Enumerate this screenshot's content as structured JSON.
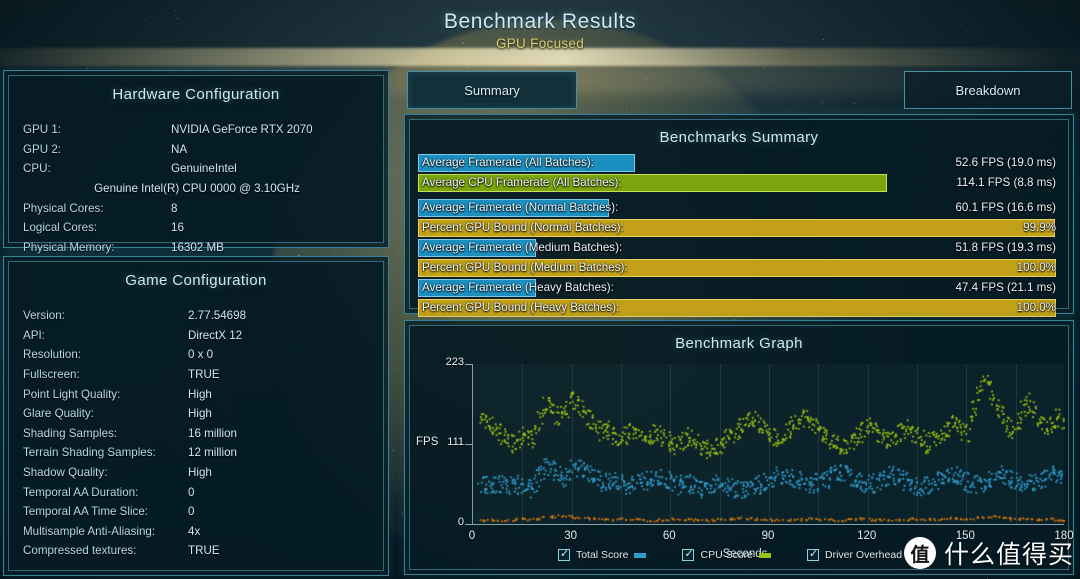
{
  "header": {
    "title": "Benchmark Results",
    "subtitle": "GPU Focused"
  },
  "tabs": [
    {
      "id": "summary",
      "label": "Summary",
      "active": true
    },
    {
      "id": "breakdown",
      "label": "Breakdown",
      "active": false
    }
  ],
  "hardware": {
    "title": "Hardware Configuration",
    "rows": [
      {
        "key": "GPU 1:",
        "value": "NVIDIA GeForce RTX 2070"
      },
      {
        "key": "GPU 2:",
        "value": "NA"
      },
      {
        "key": "CPU:",
        "value": "GenuineIntel"
      },
      {
        "key": "",
        "value": "Genuine Intel(R) CPU 0000 @ 3.10GHz",
        "center": true
      },
      {
        "key": "Physical Cores:",
        "value": "8"
      },
      {
        "key": "Logical Cores:",
        "value": "16"
      },
      {
        "key": "Physical Memory:",
        "value": "16302  MB"
      }
    ]
  },
  "game": {
    "title": "Game Configuration",
    "rows": [
      {
        "key": "Version:",
        "value": "2.77.54698"
      },
      {
        "key": "API:",
        "value": "DirectX 12"
      },
      {
        "key": "Resolution:",
        "value": "0 x 0"
      },
      {
        "key": "Fullscreen:",
        "value": "TRUE"
      },
      {
        "key": "Point Light Quality:",
        "value": "High"
      },
      {
        "key": "Glare Quality:",
        "value": "High"
      },
      {
        "key": "Shading Samples:",
        "value": "16 million"
      },
      {
        "key": "Terrain Shading Samples:",
        "value": "12 million"
      },
      {
        "key": "Shadow Quality:",
        "value": "High"
      },
      {
        "key": "Temporal AA Duration:",
        "value": "0"
      },
      {
        "key": "Temporal AA Time Slice:",
        "value": "0"
      },
      {
        "key": "Multisample Anti-Aliasing:",
        "value": "4x"
      },
      {
        "key": "Compressed textures:",
        "value": "TRUE"
      }
    ]
  },
  "summary": {
    "title": "Benchmarks Summary",
    "rows": [
      {
        "label": "Average Framerate (All Batches):",
        "value": "52.6 FPS (19.0 ms)",
        "color": "blue",
        "fill_pct": 34.0,
        "gap": false
      },
      {
        "label": "Average CPU Framerate (All Batches):",
        "value": "114.1 FPS (8.8 ms)",
        "color": "green",
        "fill_pct": 73.5,
        "gap": true
      },
      {
        "label": "Average Framerate (Normal Batches):",
        "value": "60.1 FPS (16.6 ms)",
        "color": "blue",
        "fill_pct": 30.0,
        "gap": false
      },
      {
        "label": "Percent GPU Bound (Normal Batches):",
        "value": "99.9%",
        "color": "gold",
        "fill_pct": 99.9,
        "gap": false
      },
      {
        "label": "Average Framerate (Medium Batches):",
        "value": "51.8 FPS (19.3 ms)",
        "color": "blue",
        "fill_pct": 18.5,
        "gap": false
      },
      {
        "label": "Percent GPU Bound (Medium Batches):",
        "value": "100.0%",
        "color": "gold",
        "fill_pct": 100.0,
        "gap": false
      },
      {
        "label": "Average Framerate (Heavy Batches):",
        "value": "47.4 FPS (21.1 ms)",
        "color": "blue",
        "fill_pct": 18.5,
        "gap": false
      },
      {
        "label": "Percent GPU Bound (Heavy Batches):",
        "value": "100.0%",
        "color": "gold",
        "fill_pct": 100.0,
        "gap": false
      }
    ]
  },
  "graph": {
    "title": "Benchmark Graph"
  },
  "chart_data": {
    "type": "scatter",
    "title": "Benchmark Graph",
    "xlabel": "Seconds",
    "ylabel": "FPS",
    "xlim": [
      0,
      180
    ],
    "ylim": [
      0,
      223
    ],
    "xticks": [
      0,
      30,
      60,
      90,
      120,
      150,
      180
    ],
    "yticks": [
      0,
      111,
      223
    ],
    "grid": true,
    "legend_position": "bottom",
    "series": [
      {
        "name": "Total Score",
        "color": "#2f9fd0",
        "checked": true,
        "approx_range_fps": [
          42,
          95
        ],
        "mean_fps": 52.6,
        "points": [
          [
            2,
            58
          ],
          [
            4,
            56
          ],
          [
            6,
            54
          ],
          [
            8,
            57
          ],
          [
            10,
            55
          ],
          [
            12,
            53
          ],
          [
            14,
            56
          ],
          [
            16,
            52
          ],
          [
            18,
            50
          ],
          [
            20,
            72
          ],
          [
            22,
            80
          ],
          [
            24,
            76
          ],
          [
            26,
            70
          ],
          [
            28,
            66
          ],
          [
            30,
            78
          ],
          [
            32,
            82
          ],
          [
            34,
            74
          ],
          [
            36,
            68
          ],
          [
            38,
            62
          ],
          [
            40,
            58
          ],
          [
            42,
            64
          ],
          [
            44,
            60
          ],
          [
            46,
            56
          ],
          [
            48,
            54
          ],
          [
            50,
            58
          ],
          [
            52,
            62
          ],
          [
            54,
            66
          ],
          [
            56,
            70
          ],
          [
            58,
            64
          ],
          [
            60,
            58
          ],
          [
            62,
            54
          ],
          [
            64,
            60
          ],
          [
            66,
            56
          ],
          [
            68,
            52
          ],
          [
            70,
            50
          ],
          [
            72,
            54
          ],
          [
            74,
            58
          ],
          [
            76,
            56
          ],
          [
            78,
            52
          ],
          [
            80,
            48
          ],
          [
            82,
            46
          ],
          [
            84,
            50
          ],
          [
            86,
            54
          ],
          [
            88,
            58
          ],
          [
            90,
            62
          ],
          [
            92,
            66
          ],
          [
            94,
            70
          ],
          [
            96,
            68
          ],
          [
            98,
            64
          ],
          [
            100,
            60
          ],
          [
            102,
            56
          ],
          [
            104,
            58
          ],
          [
            106,
            62
          ],
          [
            108,
            66
          ],
          [
            110,
            70
          ],
          [
            112,
            72
          ],
          [
            114,
            68
          ],
          [
            116,
            64
          ],
          [
            118,
            60
          ],
          [
            120,
            56
          ],
          [
            122,
            58
          ],
          [
            124,
            62
          ],
          [
            126,
            66
          ],
          [
            128,
            70
          ],
          [
            130,
            64
          ],
          [
            132,
            58
          ],
          [
            134,
            54
          ],
          [
            136,
            52
          ],
          [
            138,
            56
          ],
          [
            140,
            60
          ],
          [
            142,
            64
          ],
          [
            144,
            68
          ],
          [
            146,
            72
          ],
          [
            148,
            66
          ],
          [
            150,
            60
          ],
          [
            152,
            56
          ],
          [
            154,
            58
          ],
          [
            156,
            62
          ],
          [
            158,
            66
          ],
          [
            160,
            70
          ],
          [
            162,
            68
          ],
          [
            164,
            64
          ],
          [
            166,
            60
          ],
          [
            168,
            56
          ],
          [
            170,
            58
          ],
          [
            172,
            62
          ],
          [
            174,
            66
          ],
          [
            176,
            70
          ],
          [
            178,
            68
          ],
          [
            180,
            64
          ]
        ]
      },
      {
        "name": "CPU Score",
        "color": "#9ac10f",
        "checked": true,
        "approx_range_fps": [
          90,
          200
        ],
        "mean_fps": 114.1,
        "points": [
          [
            2,
            140
          ],
          [
            4,
            148
          ],
          [
            6,
            136
          ],
          [
            8,
            128
          ],
          [
            10,
            120
          ],
          [
            12,
            112
          ],
          [
            14,
            118
          ],
          [
            16,
            124
          ],
          [
            18,
            116
          ],
          [
            20,
            150
          ],
          [
            22,
            172
          ],
          [
            24,
            158
          ],
          [
            26,
            146
          ],
          [
            28,
            160
          ],
          [
            30,
            174
          ],
          [
            32,
            166
          ],
          [
            34,
            152
          ],
          [
            36,
            140
          ],
          [
            38,
            130
          ],
          [
            40,
            136
          ],
          [
            42,
            128
          ],
          [
            44,
            120
          ],
          [
            46,
            124
          ],
          [
            48,
            132
          ],
          [
            50,
            126
          ],
          [
            52,
            118
          ],
          [
            54,
            124
          ],
          [
            56,
            130
          ],
          [
            58,
            122
          ],
          [
            60,
            116
          ],
          [
            62,
            110
          ],
          [
            64,
            118
          ],
          [
            66,
            124
          ],
          [
            68,
            116
          ],
          [
            70,
            108
          ],
          [
            72,
            104
          ],
          [
            74,
            110
          ],
          [
            76,
            116
          ],
          [
            78,
            122
          ],
          [
            80,
            130
          ],
          [
            82,
            140
          ],
          [
            84,
            150
          ],
          [
            86,
            144
          ],
          [
            88,
            136
          ],
          [
            90,
            128
          ],
          [
            92,
            120
          ],
          [
            94,
            126
          ],
          [
            96,
            134
          ],
          [
            98,
            142
          ],
          [
            100,
            150
          ],
          [
            102,
            144
          ],
          [
            104,
            136
          ],
          [
            106,
            128
          ],
          [
            108,
            120
          ],
          [
            110,
            114
          ],
          [
            112,
            108
          ],
          [
            114,
            114
          ],
          [
            116,
            122
          ],
          [
            118,
            130
          ],
          [
            120,
            138
          ],
          [
            122,
            130
          ],
          [
            124,
            122
          ],
          [
            126,
            114
          ],
          [
            128,
            120
          ],
          [
            130,
            128
          ],
          [
            132,
            136
          ],
          [
            134,
            128
          ],
          [
            136,
            120
          ],
          [
            138,
            112
          ],
          [
            140,
            118
          ],
          [
            142,
            126
          ],
          [
            144,
            134
          ],
          [
            146,
            142
          ],
          [
            148,
            134
          ],
          [
            150,
            126
          ],
          [
            152,
            160
          ],
          [
            154,
            186
          ],
          [
            156,
            200
          ],
          [
            158,
            178
          ],
          [
            160,
            156
          ],
          [
            162,
            140
          ],
          [
            164,
            132
          ],
          [
            166,
            150
          ],
          [
            168,
            172
          ],
          [
            170,
            160
          ],
          [
            172,
            146
          ],
          [
            174,
            136
          ],
          [
            176,
            144
          ],
          [
            178,
            152
          ],
          [
            180,
            140
          ]
        ]
      },
      {
        "name": "Driver Overhead",
        "color": "#d2780e",
        "checked": true,
        "approx_range_fps": [
          2,
          14
        ],
        "points": [
          [
            2,
            6
          ],
          [
            6,
            7
          ],
          [
            10,
            6
          ],
          [
            14,
            8
          ],
          [
            18,
            7
          ],
          [
            22,
            10
          ],
          [
            26,
            12
          ],
          [
            30,
            11
          ],
          [
            34,
            9
          ],
          [
            38,
            8
          ],
          [
            42,
            7
          ],
          [
            46,
            8
          ],
          [
            50,
            7
          ],
          [
            54,
            6
          ],
          [
            58,
            7
          ],
          [
            62,
            8
          ],
          [
            66,
            7
          ],
          [
            70,
            6
          ],
          [
            74,
            7
          ],
          [
            78,
            8
          ],
          [
            82,
            9
          ],
          [
            86,
            8
          ],
          [
            90,
            7
          ],
          [
            94,
            6
          ],
          [
            98,
            7
          ],
          [
            102,
            8
          ],
          [
            106,
            7
          ],
          [
            110,
            6
          ],
          [
            114,
            7
          ],
          [
            118,
            8
          ],
          [
            122,
            7
          ],
          [
            126,
            6
          ],
          [
            130,
            7
          ],
          [
            134,
            8
          ],
          [
            138,
            7
          ],
          [
            142,
            8
          ],
          [
            146,
            9
          ],
          [
            150,
            8
          ],
          [
            154,
            10
          ],
          [
            158,
            12
          ],
          [
            162,
            9
          ],
          [
            166,
            8
          ],
          [
            170,
            7
          ],
          [
            174,
            8
          ],
          [
            178,
            7
          ],
          [
            180,
            6
          ]
        ]
      }
    ],
    "legend": [
      {
        "label": "Total Score",
        "color": "#2f9fd0",
        "checked": true
      },
      {
        "label": "CPU Score",
        "color": "#9ac10f",
        "checked": true
      },
      {
        "label": "Driver Overhead",
        "color": "#d2780e",
        "checked": true
      }
    ]
  },
  "watermark": {
    "badge": "值",
    "text": "什么值得买"
  }
}
